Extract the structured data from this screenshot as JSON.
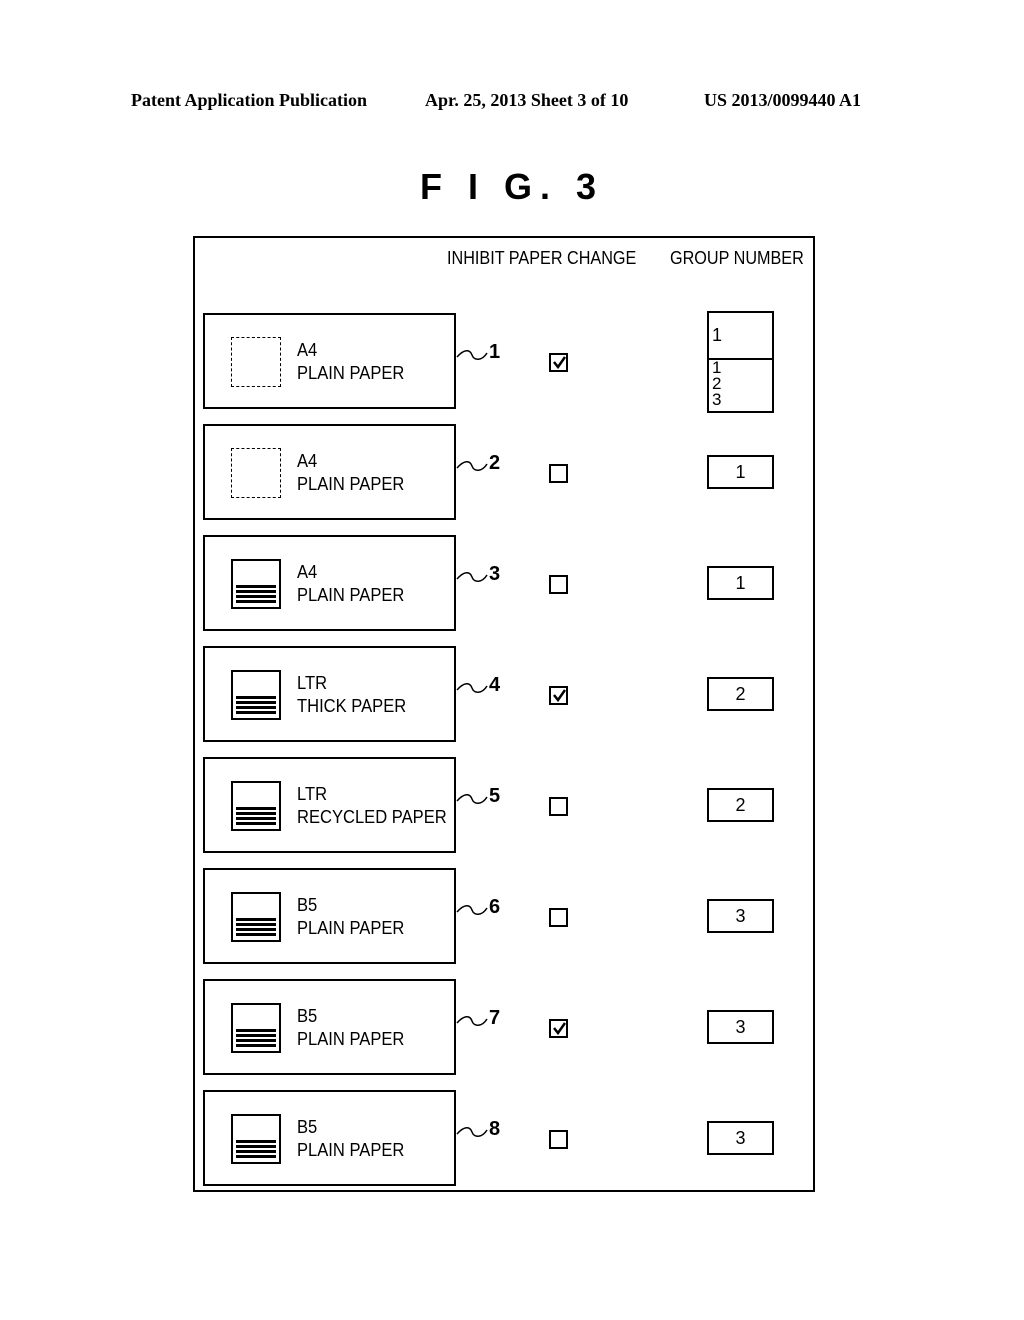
{
  "header": {
    "left": "Patent Application Publication",
    "center": "Apr. 25, 2013  Sheet 3 of 10",
    "right": "US 2013/0099440 A1"
  },
  "figure_title": "F I G.   3",
  "columns": {
    "inhibit": "INHIBIT PAPER CHANGE",
    "group": "GROUP NUMBER"
  },
  "rows": [
    {
      "ref": "1",
      "size": "A4",
      "type": "PLAIN PAPER",
      "loaded": false,
      "inhibit": true,
      "group": "1",
      "dropdown_open": true,
      "group_options": [
        "1",
        "2",
        "3"
      ]
    },
    {
      "ref": "2",
      "size": "A4",
      "type": "PLAIN PAPER",
      "loaded": false,
      "inhibit": false,
      "group": "1"
    },
    {
      "ref": "3",
      "size": "A4",
      "type": "PLAIN PAPER",
      "loaded": true,
      "inhibit": false,
      "group": "1"
    },
    {
      "ref": "4",
      "size": "LTR",
      "type": "THICK PAPER",
      "loaded": true,
      "inhibit": true,
      "group": "2"
    },
    {
      "ref": "5",
      "size": "LTR",
      "type": "RECYCLED PAPER",
      "loaded": true,
      "inhibit": false,
      "group": "2"
    },
    {
      "ref": "6",
      "size": "B5",
      "type": "PLAIN PAPER",
      "loaded": true,
      "inhibit": false,
      "group": "3"
    },
    {
      "ref": "7",
      "size": "B5",
      "type": "PLAIN PAPER",
      "loaded": true,
      "inhibit": true,
      "group": "3"
    },
    {
      "ref": "8",
      "size": "B5",
      "type": "PLAIN PAPER",
      "loaded": true,
      "inhibit": false,
      "group": "3"
    }
  ]
}
